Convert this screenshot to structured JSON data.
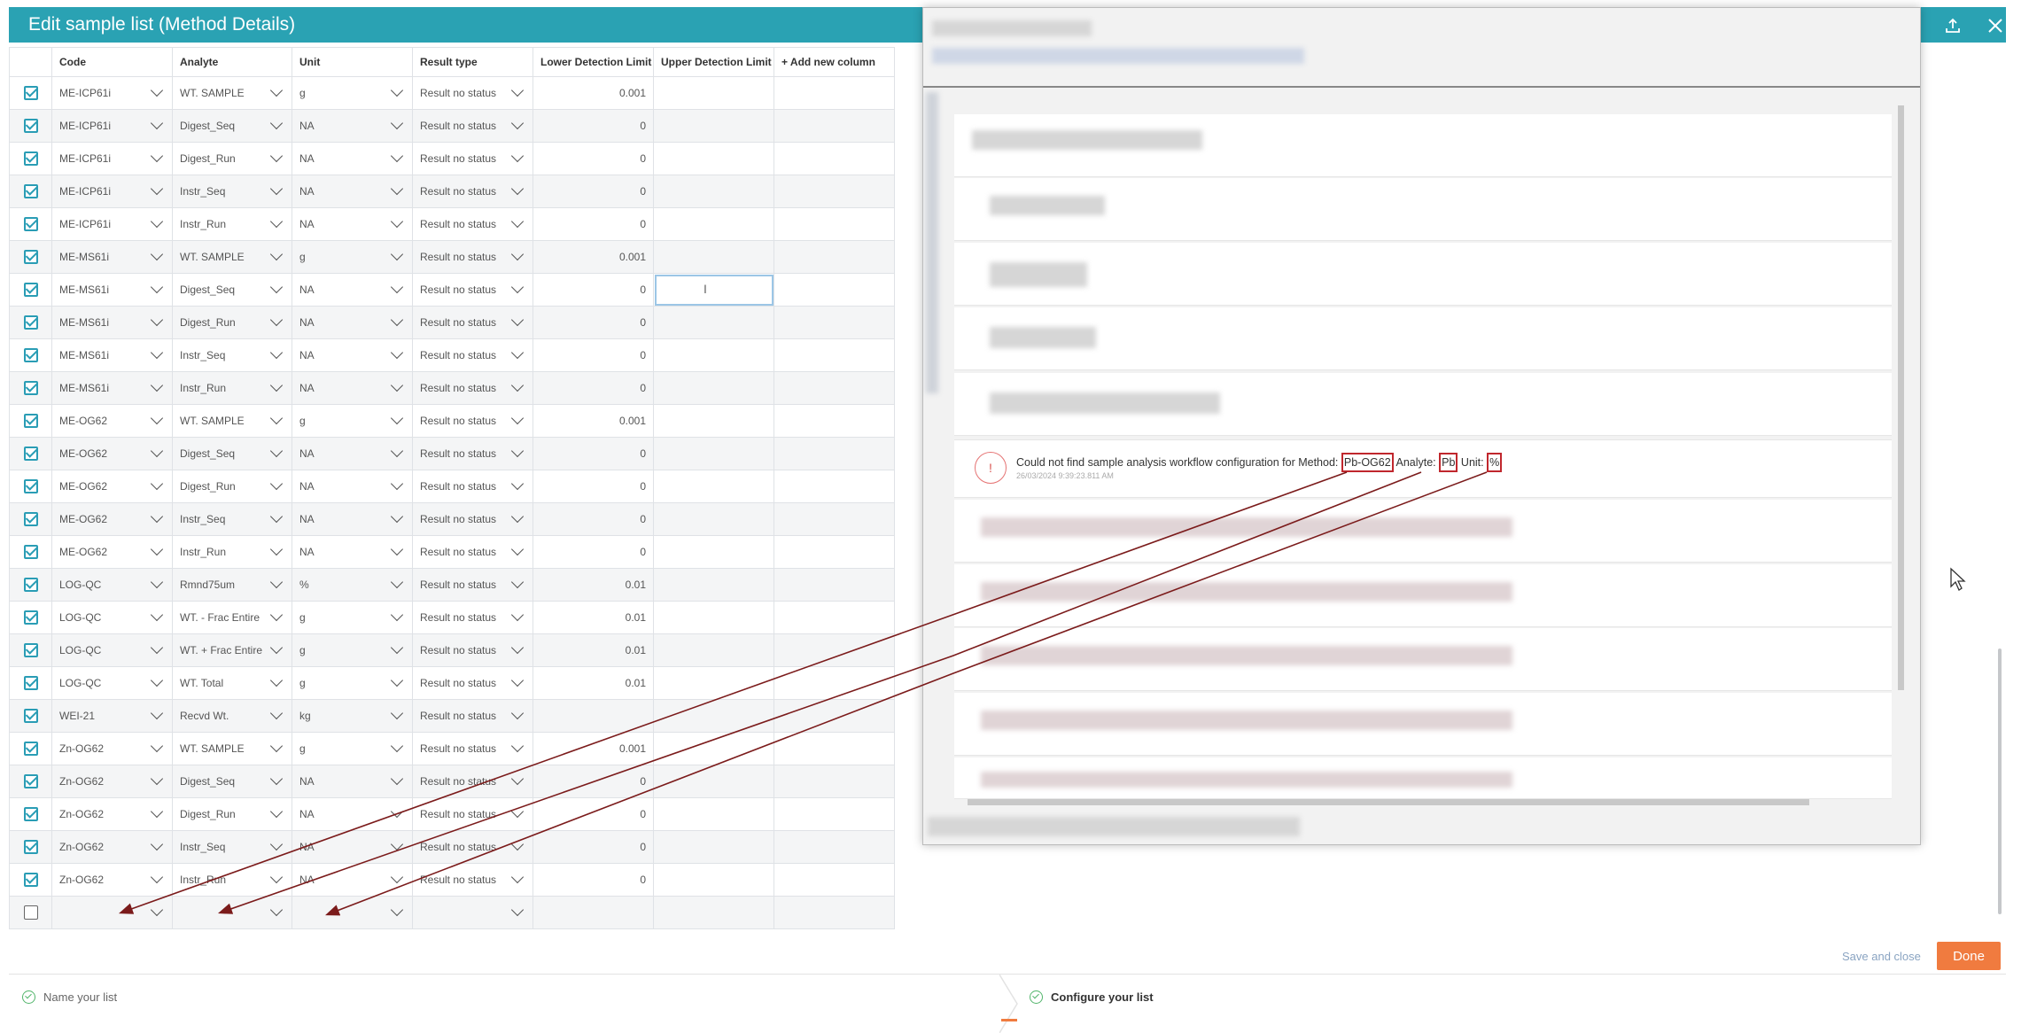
{
  "header": {
    "title": "Edit sample list (Method Details)",
    "icons": [
      "upload-icon",
      "close-icon"
    ]
  },
  "table": {
    "columns": [
      "Code",
      "Analyte",
      "Unit",
      "Result type",
      "Lower Detection Limit",
      "Upper Detection Limit",
      "+ Add new column"
    ],
    "rows": [
      {
        "code": "ME-ICP61i",
        "analyte": "WT. SAMPLE",
        "unit": "g",
        "result": "Result no status",
        "ldl": "0.001",
        "checked": true
      },
      {
        "code": "ME-ICP61i",
        "analyte": "Digest_Seq",
        "unit": "NA",
        "result": "Result no status",
        "ldl": "0",
        "checked": true
      },
      {
        "code": "ME-ICP61i",
        "analyte": "Digest_Run",
        "unit": "NA",
        "result": "Result no status",
        "ldl": "0",
        "checked": true
      },
      {
        "code": "ME-ICP61i",
        "analyte": "Instr_Seq",
        "unit": "NA",
        "result": "Result no status",
        "ldl": "0",
        "checked": true
      },
      {
        "code": "ME-ICP61i",
        "analyte": "Instr_Run",
        "unit": "NA",
        "result": "Result no status",
        "ldl": "0",
        "checked": true
      },
      {
        "code": "ME-MS61i",
        "analyte": "WT. SAMPLE",
        "unit": "g",
        "result": "Result no status",
        "ldl": "0.001",
        "checked": true
      },
      {
        "code": "ME-MS61i",
        "analyte": "Digest_Seq",
        "unit": "NA",
        "result": "Result no status",
        "ldl": "0",
        "checked": true
      },
      {
        "code": "ME-MS61i",
        "analyte": "Digest_Run",
        "unit": "NA",
        "result": "Result no status",
        "ldl": "0",
        "checked": true
      },
      {
        "code": "ME-MS61i",
        "analyte": "Instr_Seq",
        "unit": "NA",
        "result": "Result no status",
        "ldl": "0",
        "checked": true
      },
      {
        "code": "ME-MS61i",
        "analyte": "Instr_Run",
        "unit": "NA",
        "result": "Result no status",
        "ldl": "0",
        "checked": true
      },
      {
        "code": "ME-OG62",
        "analyte": "WT. SAMPLE",
        "unit": "g",
        "result": "Result no status",
        "ldl": "0.001",
        "checked": true
      },
      {
        "code": "ME-OG62",
        "analyte": "Digest_Seq",
        "unit": "NA",
        "result": "Result no status",
        "ldl": "0",
        "checked": true
      },
      {
        "code": "ME-OG62",
        "analyte": "Digest_Run",
        "unit": "NA",
        "result": "Result no status",
        "ldl": "0",
        "checked": true
      },
      {
        "code": "ME-OG62",
        "analyte": "Instr_Seq",
        "unit": "NA",
        "result": "Result no status",
        "ldl": "0",
        "checked": true
      },
      {
        "code": "ME-OG62",
        "analyte": "Instr_Run",
        "unit": "NA",
        "result": "Result no status",
        "ldl": "0",
        "checked": true
      },
      {
        "code": "LOG-QC",
        "analyte": "Rmnd75um",
        "unit": "%",
        "result": "Result no status",
        "ldl": "0.01",
        "checked": true
      },
      {
        "code": "LOG-QC",
        "analyte": "WT. - Frac Entire",
        "unit": "g",
        "result": "Result no status",
        "ldl": "0.01",
        "checked": true
      },
      {
        "code": "LOG-QC",
        "analyte": "WT. + Frac Entire",
        "unit": "g",
        "result": "Result no status",
        "ldl": "0.01",
        "checked": true
      },
      {
        "code": "LOG-QC",
        "analyte": "WT. Total",
        "unit": "g",
        "result": "Result no status",
        "ldl": "0.01",
        "checked": true
      },
      {
        "code": "WEI-21",
        "analyte": "Recvd Wt.",
        "unit": "kg",
        "result": "Result no status",
        "ldl": "",
        "checked": true
      },
      {
        "code": "Zn-OG62",
        "analyte": "WT. SAMPLE",
        "unit": "g",
        "result": "Result no status",
        "ldl": "0.001",
        "checked": true
      },
      {
        "code": "Zn-OG62",
        "analyte": "Digest_Seq",
        "unit": "NA",
        "result": "Result no status",
        "ldl": "0",
        "checked": true
      },
      {
        "code": "Zn-OG62",
        "analyte": "Digest_Run",
        "unit": "NA",
        "result": "Result no status",
        "ldl": "0",
        "checked": true
      },
      {
        "code": "Zn-OG62",
        "analyte": "Instr_Seq",
        "unit": "NA",
        "result": "Result no status",
        "ldl": "0",
        "checked": true
      },
      {
        "code": "Zn-OG62",
        "analyte": "Instr_Run",
        "unit": "NA",
        "result": "Result no status",
        "ldl": "0",
        "checked": true
      },
      {
        "code": "",
        "analyte": "",
        "unit": "",
        "result": "",
        "ldl": "",
        "checked": false
      }
    ],
    "focused_row": 6
  },
  "overlay": {
    "error_message": {
      "prefix": "Could not find sample analysis workflow configuration for Method:",
      "method": "Pb-OG62",
      "analyte_label": "Analyte:",
      "analyte": "Pb",
      "unit_label": "Unit:",
      "unit": "%",
      "timestamp": "26/03/2024 9:39:23.811 AM",
      "icon": "!"
    }
  },
  "footer": {
    "save_close": "Save and close",
    "done": "Done",
    "steps": [
      "Name your list",
      "Configure your list"
    ]
  },
  "colors": {
    "accent": "#2aa2b3",
    "done": "#f07b3f",
    "highlight": "#c0272d",
    "arrow": "#7b1b1b"
  }
}
